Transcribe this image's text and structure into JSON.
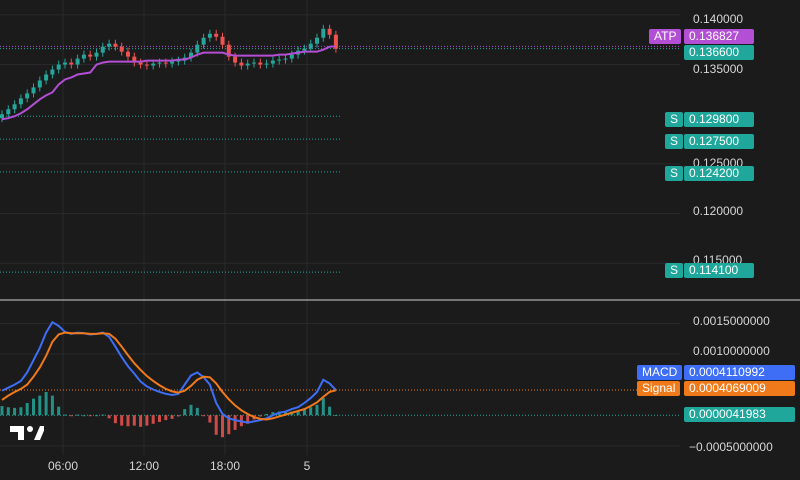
{
  "colors": {
    "background": "#1b1b1c",
    "grid": "#2a2a2c",
    "up": "#26a69a",
    "down": "#ef5350",
    "atp_line": "#b24fd4",
    "macd_line": "#3d6ef5",
    "signal_line": "#f07a1a",
    "level_line": "#1ea79a",
    "divider": "#d0d0d0"
  },
  "price_axis": {
    "ticks": [
      "0.140000",
      "0.135000",
      "0.125000",
      "0.120000",
      "0.115000"
    ]
  },
  "macd_axis": {
    "ticks": [
      "0.0015000000",
      "0.0010000000",
      "−0.0005000000"
    ]
  },
  "time_axis": {
    "ticks": [
      "06:00",
      "12:00",
      "18:00",
      "5"
    ]
  },
  "tags": {
    "atp_label": "ATP",
    "atp_value": "0.136827",
    "last_price": "0.136600",
    "support_letter": "S",
    "supports": [
      "0.129800",
      "0.127500",
      "0.124200",
      "0.114100"
    ],
    "macd_label": "MACD",
    "macd_value": "0.0004110992",
    "signal_label": "Signal",
    "signal_value": "0.0004069009",
    "hist_value": "0.0000041983"
  },
  "chart_data": {
    "type": "candlestick",
    "price_ylim": [
      0.1115,
      0.1415
    ],
    "macd_ylim": [
      -0.00065,
      0.00185
    ],
    "price_series": {
      "x_start": "00:00",
      "x_step_minutes": 15,
      "close": [
        0.13,
        0.1305,
        0.131,
        0.1316,
        0.1321,
        0.1327,
        0.1334,
        0.134,
        0.1345,
        0.135,
        0.1352,
        0.135,
        0.1356,
        0.136,
        0.1358,
        0.1362,
        0.1368,
        0.1371,
        0.1368,
        0.1363,
        0.1358,
        0.1352,
        0.135,
        0.1349,
        0.1351,
        0.1352,
        0.1351,
        0.1353,
        0.1354,
        0.1357,
        0.1362,
        0.137,
        0.1377,
        0.1381,
        0.1378,
        0.137,
        0.1358,
        0.1352,
        0.1349,
        0.1351,
        0.1352,
        0.135,
        0.1351,
        0.1354,
        0.1355,
        0.1356,
        0.136,
        0.1364,
        0.1366,
        0.1371,
        0.1377,
        0.1386,
        0.138,
        0.1366
      ]
    },
    "atp_series": [
      0.1295,
      0.1296,
      0.1298,
      0.1301,
      0.1305,
      0.131,
      0.1315,
      0.1319,
      0.1322,
      0.133,
      0.1335,
      0.1337,
      0.134,
      0.1341,
      0.1342,
      0.135,
      0.1352,
      0.1353,
      0.1353,
      0.1353,
      0.1353,
      0.1353,
      0.1353,
      0.1354,
      0.1354,
      0.1354,
      0.1354,
      0.1354,
      0.1355,
      0.1355,
      0.1357,
      0.136,
      0.1362,
      0.1362,
      0.1362,
      0.1362,
      0.136,
      0.1359,
      0.1359,
      0.1359,
      0.1359,
      0.1359,
      0.1359,
      0.1359,
      0.136,
      0.136,
      0.1361,
      0.1362,
      0.1363,
      0.1363,
      0.1363,
      0.1365,
      0.1368,
      0.136827
    ],
    "support_levels": [
      0.1298,
      0.1275,
      0.1242,
      0.1141
    ],
    "macd": [
      0.0004,
      0.00045,
      0.0005,
      0.00056,
      0.0007,
      0.0009,
      0.0011,
      0.00135,
      0.00152,
      0.00146,
      0.00136,
      0.00133,
      0.00135,
      0.00134,
      0.00132,
      0.00133,
      0.00135,
      0.00128,
      0.00112,
      0.00095,
      0.0008,
      0.00068,
      0.00055,
      0.00047,
      0.00042,
      0.00038,
      0.00035,
      0.00033,
      0.00035,
      0.0005,
      0.00065,
      0.0007,
      0.00062,
      0.0005,
      0.0002,
      2e-05,
      -5e-05,
      -8e-05,
      -0.0001,
      -0.00012,
      -0.0001,
      -8e-05,
      -5e-05,
      0.0,
      4e-05,
      6e-05,
      0.0001,
      0.00013,
      0.0002,
      0.00028,
      0.00038,
      0.00058,
      0.00052,
      0.0004110992
    ],
    "signal": [
      0.00025,
      0.00032,
      0.00038,
      0.00043,
      0.0005,
      0.00063,
      0.00078,
      0.00097,
      0.0012,
      0.00132,
      0.00135,
      0.00134,
      0.00134,
      0.00134,
      0.00133,
      0.00133,
      0.00134,
      0.00133,
      0.00125,
      0.00112,
      0.00098,
      0.00085,
      0.00074,
      0.00064,
      0.00056,
      0.00049,
      0.00043,
      0.00039,
      0.00037,
      0.0004,
      0.00048,
      0.00058,
      0.00063,
      0.00062,
      0.00052,
      0.00038,
      0.00026,
      0.00016,
      8e-05,
      2e-05,
      -3e-05,
      -6e-05,
      -7e-05,
      -5e-05,
      -2e-05,
      1e-05,
      4e-05,
      7e-05,
      0.0001,
      0.00015,
      0.00021,
      0.0003,
      0.00038,
      0.0004069009
    ]
  }
}
